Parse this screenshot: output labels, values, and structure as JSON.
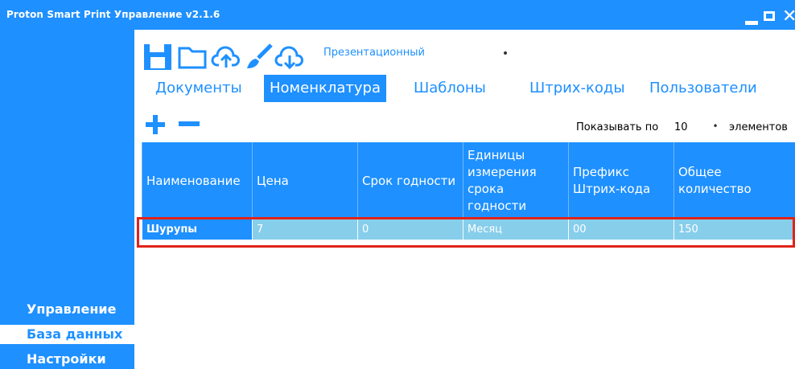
{
  "app": {
    "title": "Proton Smart Print Управление v2.1.6"
  },
  "colors": {
    "accent": "#1e90ff",
    "row_bg": "#87ceeb",
    "highlight": "#e2231a"
  },
  "toolbar": {
    "icons": [
      "save-icon",
      "folder-icon",
      "cloud-upload-icon",
      "brush-icon",
      "cloud-download-icon"
    ],
    "profile": "Презентационный"
  },
  "tabs": [
    {
      "label": "Документы"
    },
    {
      "label": "Номенклатура"
    },
    {
      "label": "Шаблоны"
    },
    {
      "label": "Штрих-коды"
    },
    {
      "label": "Пользователи"
    }
  ],
  "active_tab": "Номенклатура",
  "list_controls": {
    "show_label": "Показывать по",
    "page_size": "10",
    "suffix": "элементов"
  },
  "table": {
    "columns": [
      "Наименование",
      "Цена",
      "Срок годности",
      "Единицы измерения срока годности",
      "Префикс Штрих-кода",
      "Общее количество"
    ],
    "rows": [
      [
        "Шурупы",
        "7",
        "0",
        "Месяц",
        "00",
        "150"
      ]
    ]
  },
  "sidebar": {
    "items": [
      {
        "label": "Управление"
      },
      {
        "label": "База данных"
      },
      {
        "label": "Настройки"
      }
    ],
    "active": "База данных"
  }
}
